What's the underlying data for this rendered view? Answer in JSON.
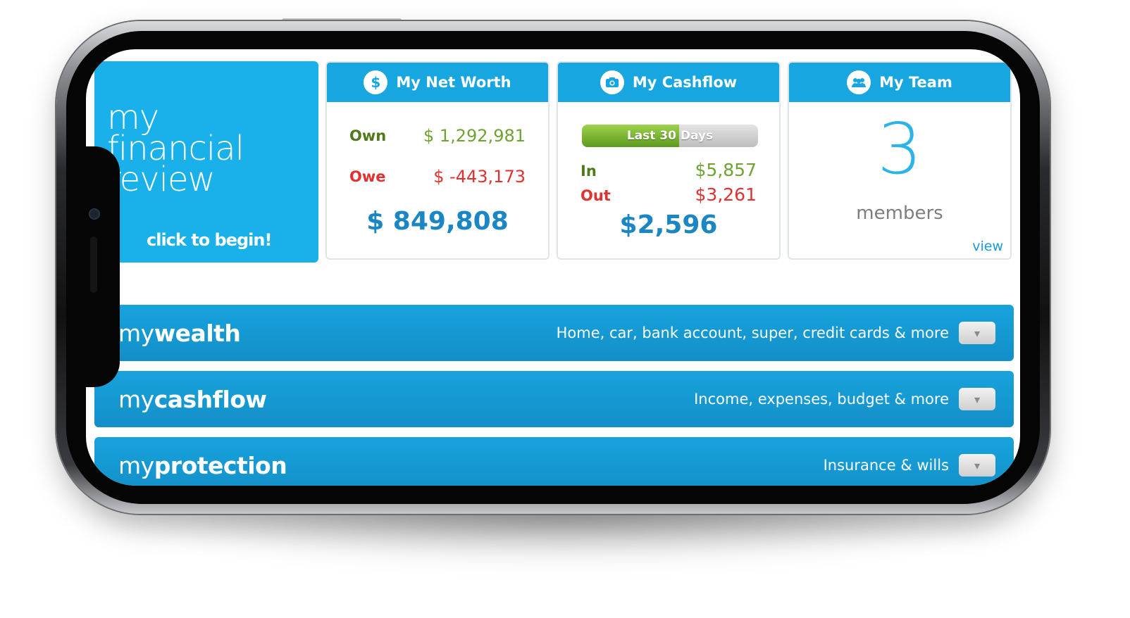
{
  "hero": {
    "title_line1": "my",
    "title_line2": "financial",
    "title_line3": "review",
    "cta": "click to begin!"
  },
  "net_worth": {
    "title": "My Net Worth",
    "icon": "dollar-icon",
    "own_label": "Own",
    "own_value": "$ 1,292,981",
    "owe_label": "Owe",
    "owe_value": "$ -443,173",
    "total": "$ 849,808"
  },
  "cashflow": {
    "title": "My Cashflow",
    "icon": "camera-icon",
    "period": "Last 30 Days",
    "period_progress": 0.55,
    "in_label": "In",
    "in_value": "$5,857",
    "out_label": "Out",
    "out_value": "$3,261",
    "total": "$2,596"
  },
  "team": {
    "title": "My Team",
    "icon": "people-icon",
    "count": "3",
    "label": "members",
    "view_link": "view"
  },
  "sections": [
    {
      "prefix": "my",
      "name": "wealth",
      "desc": "Home, car, bank account, super, credit cards & more"
    },
    {
      "prefix": "my",
      "name": "cashflow",
      "desc": "Income, expenses, budget & more"
    },
    {
      "prefix": "my",
      "name": "protection",
      "desc": "Insurance & wills"
    }
  ],
  "colors": {
    "brand_blue": "#1ab0ea",
    "positive_green": "#6fa333",
    "negative_red": "#e0322f",
    "total_blue": "#1a86c3"
  }
}
